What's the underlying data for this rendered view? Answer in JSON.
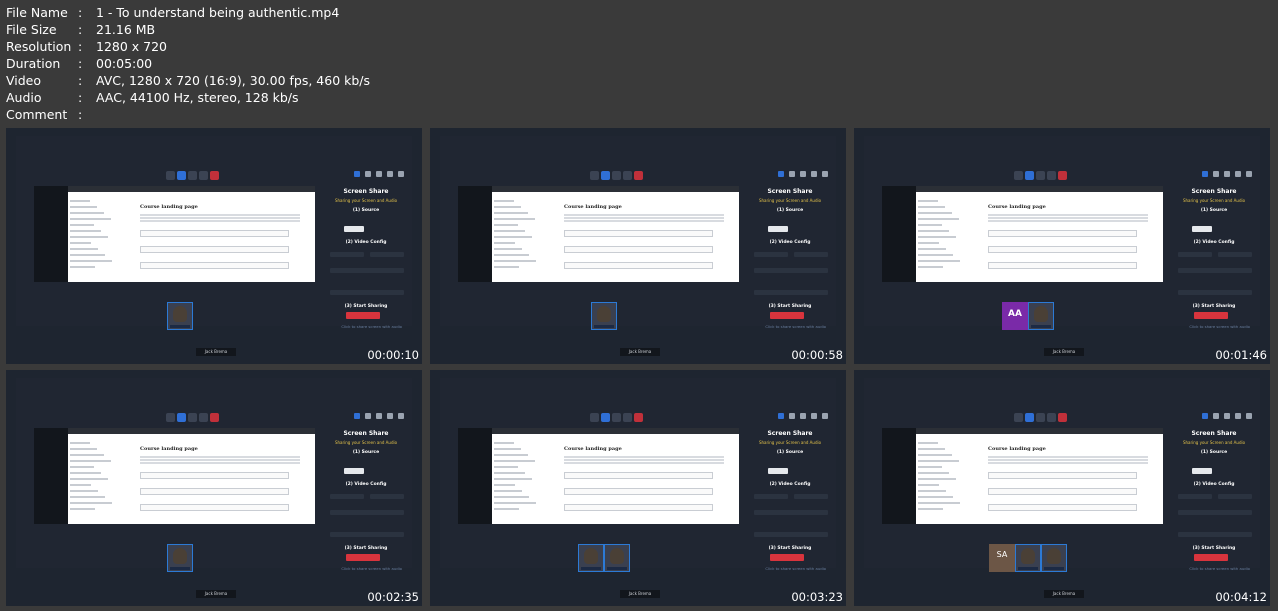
{
  "info": {
    "rows": [
      {
        "key": "File Name",
        "sep": ":",
        "value": "1 - To understand being authentic.mp4"
      },
      {
        "key": "File Size",
        "sep": ":",
        "value": "21.16 MB"
      },
      {
        "key": "Resolution",
        "sep": ":",
        "value": "1280 x 720"
      },
      {
        "key": "Duration",
        "sep": ":",
        "value": "00:05:00"
      },
      {
        "key": "Video",
        "sep": ":",
        "value": "AVC, 1280 x 720 (16:9), 30.00 fps, 460 kb/s"
      },
      {
        "key": "Audio",
        "sep": ":",
        "value": "AAC, 44100 Hz, stereo, 128 kb/s"
      },
      {
        "key": "Comment",
        "sep": ":",
        "value": ""
      }
    ]
  },
  "thumbs": [
    {
      "timestamp": "00:00:10",
      "participants": [
        "cam"
      ]
    },
    {
      "timestamp": "00:00:58",
      "participants": [
        "cam"
      ]
    },
    {
      "timestamp": "00:01:46",
      "participants": [
        "aa",
        "cam"
      ]
    },
    {
      "timestamp": "00:02:35",
      "participants": [
        "cam"
      ]
    },
    {
      "timestamp": "00:03:23",
      "participants": [
        "cam",
        "cam"
      ]
    },
    {
      "timestamp": "00:04:12",
      "participants": [
        "sa",
        "cam",
        "cam"
      ]
    }
  ],
  "frame_text": {
    "panel_title": "Screen Share",
    "panel_subtitle": "Sharing your Screen and Audio",
    "section1": "(1) Source",
    "section2": "(2) Video Config",
    "section3": "(3) Start Sharing",
    "stop_label": "Stop Sharing",
    "doc_title": "Course landing page",
    "name_label": "Jack Brema",
    "aa_label": "AA",
    "sa_label": "SA",
    "bottom_link": "Click to share screen with audio"
  },
  "colors": {
    "background": "#3a3a3a",
    "tile": "#1e2530",
    "accent": "#2f6fd6",
    "stop": "#d8343d",
    "avatar_aa": "#7a2aa8"
  }
}
